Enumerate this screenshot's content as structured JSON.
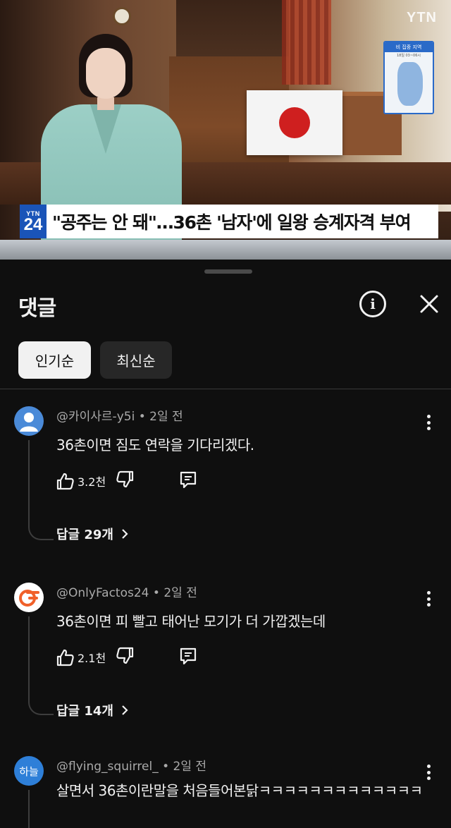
{
  "video": {
    "channel_logo": "YTN",
    "badge_top": "YTN",
    "badge_num": "24",
    "headline": "\"공주는 안 돼\"…36촌 '남자'에 일왕 승계자격 부여",
    "map_title": "비 집중 지역",
    "map_sub": "18일 03~06시"
  },
  "sheet": {
    "title": "댓글",
    "info_icon": "info-icon",
    "close_icon": "close-icon",
    "sort_chips": [
      "인기순",
      "최신순"
    ]
  },
  "comments": [
    {
      "author": "@카이사르-y5i",
      "time": "2일 전",
      "text": "36촌이면 짐도 연락을 기다리겠다.",
      "likes": "3.2천",
      "replies": "답글 29개",
      "avatar": "person-icon"
    },
    {
      "author": "@OnlyFactos24",
      "time": "2일 전",
      "text": "36촌이면 피 빨고 태어난 모기가 더 가깝겠는데",
      "likes": "2.1천",
      "replies": "답글 14개",
      "avatar": "logo-icon"
    },
    {
      "author": "@flying_squirrel_",
      "time": "2일 전",
      "text": "살면서 36촌이란말을 처음들어본닭ㅋㅋㅋㅋㅋㅋㅋㅋㅋㅋㅋㅋㅋ",
      "avatar_text": "하늘"
    }
  ],
  "colors": {
    "background": "#0f0f0f",
    "text": "#f1f1f1",
    "muted": "#aaaaaa",
    "chip_active": "#f1f1f1",
    "chip_idle": "#272727",
    "badge_blue": "#1a54b8"
  }
}
